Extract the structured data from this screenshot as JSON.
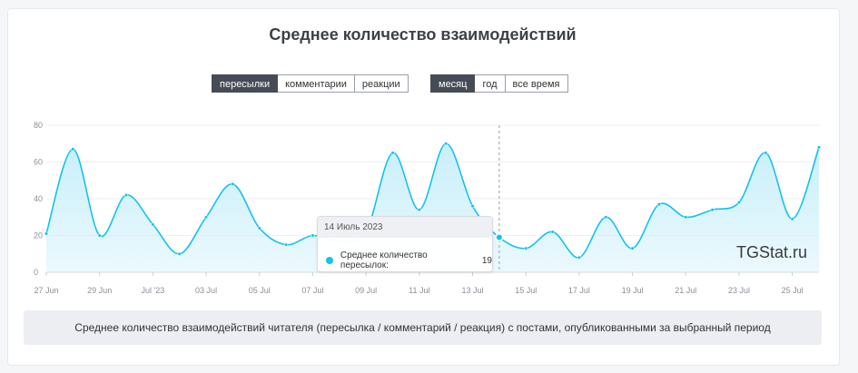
{
  "title": "Среднее количество взаимодействий",
  "type_tabs": [
    "пересылки",
    "комментарии",
    "реакции"
  ],
  "period_tabs": [
    "месяц",
    "год",
    "все время"
  ],
  "tooltip": {
    "date": "14 Июль 2023",
    "label": "Среднее количество пересылок:",
    "value": "19"
  },
  "watermark": "TGStat.ru",
  "footer_note": "Среднее количество взаимодействий читателя (пересылка / комментарий / реакция) с постами, опубликованными за выбранный период",
  "colors": {
    "line": "#14c2ee",
    "fill": "#c6eefa",
    "active_tab": "#464c55"
  },
  "chart_data": {
    "type": "area",
    "ylim": [
      0,
      80
    ],
    "y_ticks": [
      0,
      20,
      40,
      60,
      80
    ],
    "x_tick_labels": [
      "27 Jun",
      "29 Jun",
      "Jul '23",
      "03 Jul",
      "05 Jul",
      "07 Jul",
      "09 Jul",
      "11 Jul",
      "13 Jul",
      "15 Jul",
      "17 Jul",
      "19 Jul",
      "21 Jul",
      "23 Jul",
      "25 Jul"
    ],
    "x": [
      "27 Jun",
      "28 Jun",
      "29 Jun",
      "30 Jun",
      "01 Jul",
      "02 Jul",
      "03 Jul",
      "04 Jul",
      "05 Jul",
      "06 Jul",
      "07 Jul",
      "08 Jul",
      "09 Jul",
      "10 Jul",
      "11 Jul",
      "12 Jul",
      "13 Jul",
      "14 Jul",
      "15 Jul",
      "16 Jul",
      "17 Jul",
      "18 Jul",
      "19 Jul",
      "20 Jul",
      "21 Jul",
      "22 Jul",
      "23 Jul",
      "24 Jul",
      "25 Jul",
      "26 Jul"
    ],
    "series": [
      {
        "name": "Среднее количество пересылок",
        "values": [
          21,
          67,
          20,
          42,
          26,
          10,
          30,
          48,
          24,
          15,
          20,
          17,
          22,
          65,
          34,
          70,
          36,
          19,
          13,
          22,
          8,
          30,
          13,
          37,
          30,
          34,
          38,
          65,
          29,
          68
        ]
      }
    ],
    "highlight": {
      "x": "14 Jul",
      "value": 19
    },
    "grid": true
  }
}
